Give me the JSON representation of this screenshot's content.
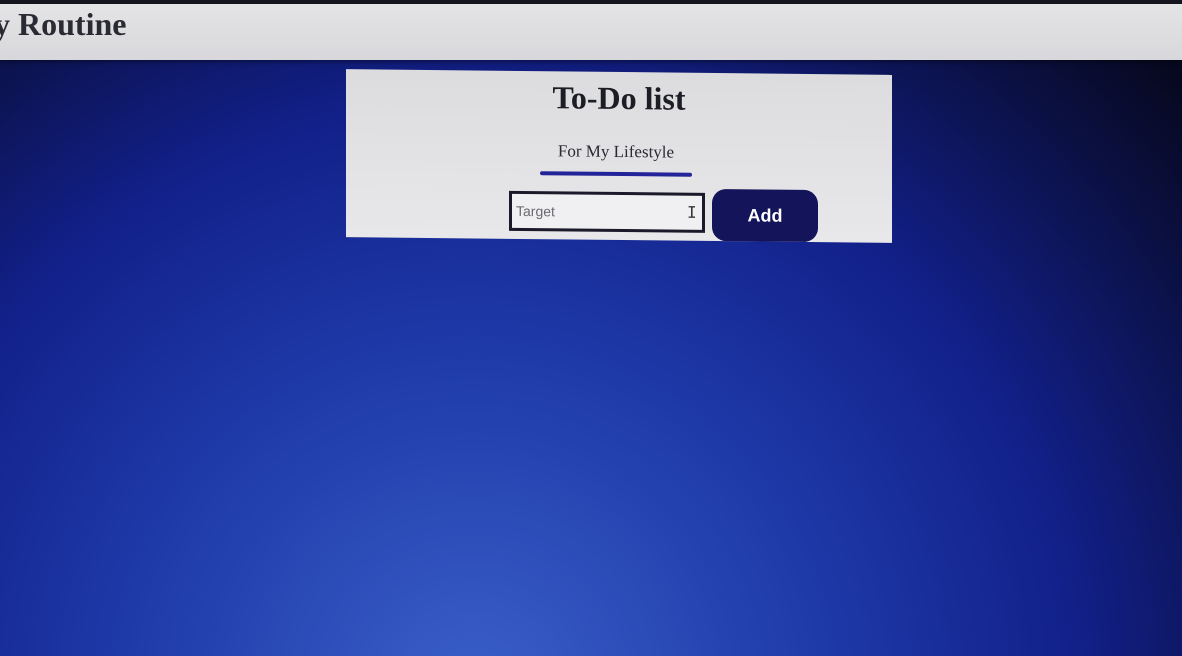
{
  "header": {
    "title": "y Routine"
  },
  "todo": {
    "title": "To-Do list",
    "subtitle": "For My Lifestyle",
    "input": {
      "placeholder": "Target",
      "value": ""
    },
    "add_label": "Add",
    "cursor_icon": "text-cursor-icon"
  },
  "colors": {
    "accent": "#24249a",
    "button": "#14145a",
    "card": "#e2e2e4",
    "background": "#12208a"
  }
}
